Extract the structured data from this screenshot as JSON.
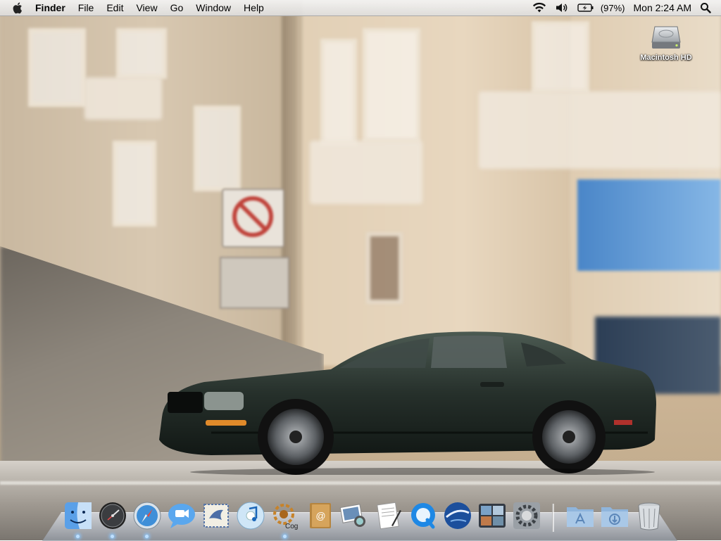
{
  "menubar": {
    "apple_icon": "apple-logo-icon",
    "app_name": "Finder",
    "menus": [
      "File",
      "Edit",
      "View",
      "Go",
      "Window",
      "Help"
    ],
    "status": {
      "wifi_icon": "wifi-icon",
      "volume_icon": "volume-icon",
      "battery_icon": "battery-charging-icon",
      "battery_percent": "(97%)",
      "clock": "Mon 2:24 AM",
      "spotlight_icon": "spotlight-search-icon"
    }
  },
  "desktop": {
    "icons": [
      {
        "label": "Macintosh HD",
        "icon": "hard-drive-icon"
      }
    ]
  },
  "dock": {
    "apps": [
      {
        "icon": "finder-icon",
        "running": true
      },
      {
        "icon": "dashboard-icon",
        "running": true
      },
      {
        "icon": "safari-icon",
        "running": true
      },
      {
        "icon": "ichat-icon",
        "running": false
      },
      {
        "icon": "mail-icon",
        "running": false
      },
      {
        "icon": "itunes-icon",
        "running": false
      },
      {
        "icon": "cog-icon",
        "label": "Cog",
        "running": true
      },
      {
        "icon": "address-book-icon",
        "running": false
      },
      {
        "icon": "iphoto-icon",
        "running": false
      },
      {
        "icon": "textedit-icon",
        "running": false
      },
      {
        "icon": "quicktime-icon",
        "running": false
      },
      {
        "icon": "google-earth-icon",
        "running": false
      },
      {
        "icon": "spaces-icon",
        "running": false
      },
      {
        "icon": "system-preferences-icon",
        "running": false
      }
    ],
    "stacks": [
      {
        "icon": "applications-folder-icon"
      },
      {
        "icon": "downloads-folder-icon"
      },
      {
        "icon": "trash-icon"
      }
    ]
  }
}
